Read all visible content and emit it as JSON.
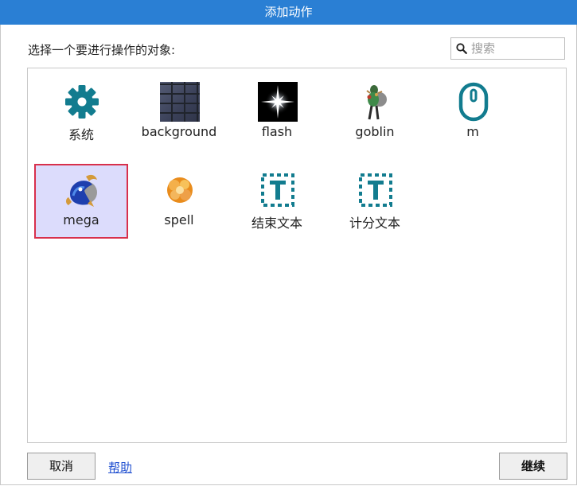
{
  "window": {
    "title": "添加动作"
  },
  "prompt": "选择一个要进行操作的对象:",
  "search": {
    "placeholder": "搜索",
    "value": ""
  },
  "objects": [
    {
      "label": "系统",
      "icon": "gear-icon",
      "selected": false
    },
    {
      "label": "background",
      "icon": "brick-wall-image",
      "selected": false
    },
    {
      "label": "flash",
      "icon": "flash-star-image",
      "selected": false
    },
    {
      "label": "goblin",
      "icon": "goblin-sprite",
      "selected": false
    },
    {
      "label": "m",
      "icon": "mouse-icon",
      "selected": false
    },
    {
      "label": "mega",
      "icon": "mega-sprite",
      "selected": true
    },
    {
      "label": "spell",
      "icon": "spell-explosion-sprite",
      "selected": false
    },
    {
      "label": "结束文本",
      "icon": "text-object-icon",
      "selected": false
    },
    {
      "label": "计分文本",
      "icon": "text-object-icon",
      "selected": false
    }
  ],
  "buttons": {
    "cancel": "取消",
    "help": "帮助",
    "continue": "继续"
  },
  "colors": {
    "titlebar": "#2a7fd4",
    "selection_fill": "#dcdcfc",
    "selection_border": "#d8304c",
    "icon_teal": "#127c8f",
    "link": "#1f4fd0"
  }
}
